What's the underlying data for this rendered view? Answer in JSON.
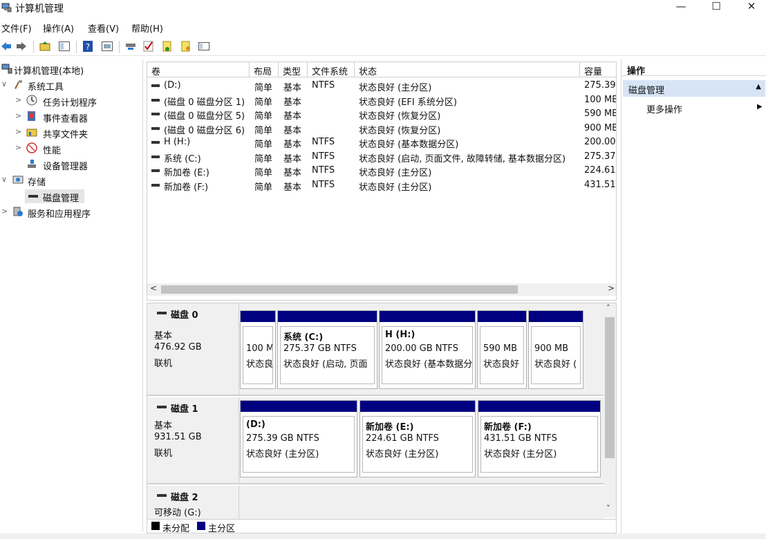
{
  "window": {
    "title": "计算机管理",
    "minimize_glyph": "—",
    "maximize_glyph": "☐",
    "close_glyph": "✕"
  },
  "menu": [
    "文件(F)",
    "操作(A)",
    "查看(V)",
    "帮助(H)"
  ],
  "toolbar": {
    "icons": [
      "back-arrow-icon",
      "forward-arrow-icon",
      "up-folder-icon",
      "show-hide-tree-icon",
      "help-icon",
      "properties-icon",
      "connect-icon",
      "check-icon",
      "new-icon",
      "open-icon",
      "console-icon"
    ]
  },
  "tree": {
    "items": [
      {
        "label": "计算机管理(本地)",
        "chevron": ""
      },
      {
        "label": "系统工具",
        "chevron": "∨"
      },
      {
        "label": "任务计划程序",
        "chevron": ">"
      },
      {
        "label": "事件查看器",
        "chevron": ">"
      },
      {
        "label": "共享文件夹",
        "chevron": ">"
      },
      {
        "label": "性能",
        "chevron": ">"
      },
      {
        "label": "设备管理器",
        "chevron": ""
      },
      {
        "label": "存储",
        "chevron": "∨"
      },
      {
        "label": "磁盘管理",
        "chevron": ""
      },
      {
        "label": "服务和应用程序",
        "chevron": ">"
      }
    ]
  },
  "volume_list": {
    "columns": [
      "卷",
      "布局",
      "类型",
      "文件系统",
      "状态",
      "容量"
    ],
    "rows": [
      [
        "(D:)",
        "简单",
        "基本",
        "NTFS",
        "状态良好 (主分区)",
        "275.39"
      ],
      [
        "(磁盘 0 磁盘分区 1)",
        "简单",
        "基本",
        "",
        "状态良好 (EFI 系统分区)",
        "100 MB"
      ],
      [
        "(磁盘 0 磁盘分区 5)",
        "简单",
        "基本",
        "",
        "状态良好 (恢复分区)",
        "590 MB"
      ],
      [
        "(磁盘 0 磁盘分区 6)",
        "简单",
        "基本",
        "",
        "状态良好 (恢复分区)",
        "900 MB"
      ],
      [
        "H (H:)",
        "简单",
        "基本",
        "NTFS",
        "状态良好 (基本数据分区)",
        "200.00"
      ],
      [
        "系统 (C:)",
        "简单",
        "基本",
        "NTFS",
        "状态良好 (启动, 页面文件, 故障转储, 基本数据分区)",
        "275.37"
      ],
      [
        "新加卷 (E:)",
        "简单",
        "基本",
        "NTFS",
        "状态良好 (主分区)",
        "224.61"
      ],
      [
        "新加卷 (F:)",
        "简单",
        "基本",
        "NTFS",
        "状态良好 (主分区)",
        "431.51"
      ]
    ],
    "scroll_left": "<",
    "scroll_right": ">"
  },
  "disks": [
    {
      "name": "磁盘 0",
      "type": "基本",
      "size": "476.92 GB",
      "status": "联机",
      "partitions": [
        {
          "name": "",
          "size": "100 M",
          "status": "状态良"
        },
        {
          "name": "系统 (C:)",
          "size": "275.37 GB NTFS",
          "status": "状态良好 (启动, 页面"
        },
        {
          "name": "H (H:)",
          "size": "200.00 GB NTFS",
          "status": "状态良好 (基本数据分"
        },
        {
          "name": "",
          "size": "590 MB",
          "status": "状态良好"
        },
        {
          "name": "",
          "size": "900 MB",
          "status": "状态良好 ("
        }
      ]
    },
    {
      "name": "磁盘 1",
      "type": "基本",
      "size": "931.51 GB",
      "status": "联机",
      "partitions": [
        {
          "name": "(D:)",
          "size": "275.39 GB NTFS",
          "status": "状态良好 (主分区)"
        },
        {
          "name": "新加卷 (E:)",
          "size": "224.61 GB NTFS",
          "status": "状态良好 (主分区)"
        },
        {
          "name": "新加卷 (F:)",
          "size": "431.51 GB NTFS",
          "status": "状态良好 (主分区)"
        }
      ]
    },
    {
      "name": "磁盘 2",
      "type": "可移动 (G:)",
      "size": "",
      "status": "",
      "partitions": []
    }
  ],
  "legend": {
    "unallocated": "未分配",
    "primary": "主分区",
    "unallocated_color": "#000000",
    "primary_color": "#000080"
  },
  "actions": {
    "header": "操作",
    "section": "磁盘管理",
    "more": "更多操作",
    "section_chevron": "▲",
    "more_arrow": "▶"
  },
  "colors": {
    "partition_bar": "#000080",
    "selected_section": "#d6e4f5"
  }
}
